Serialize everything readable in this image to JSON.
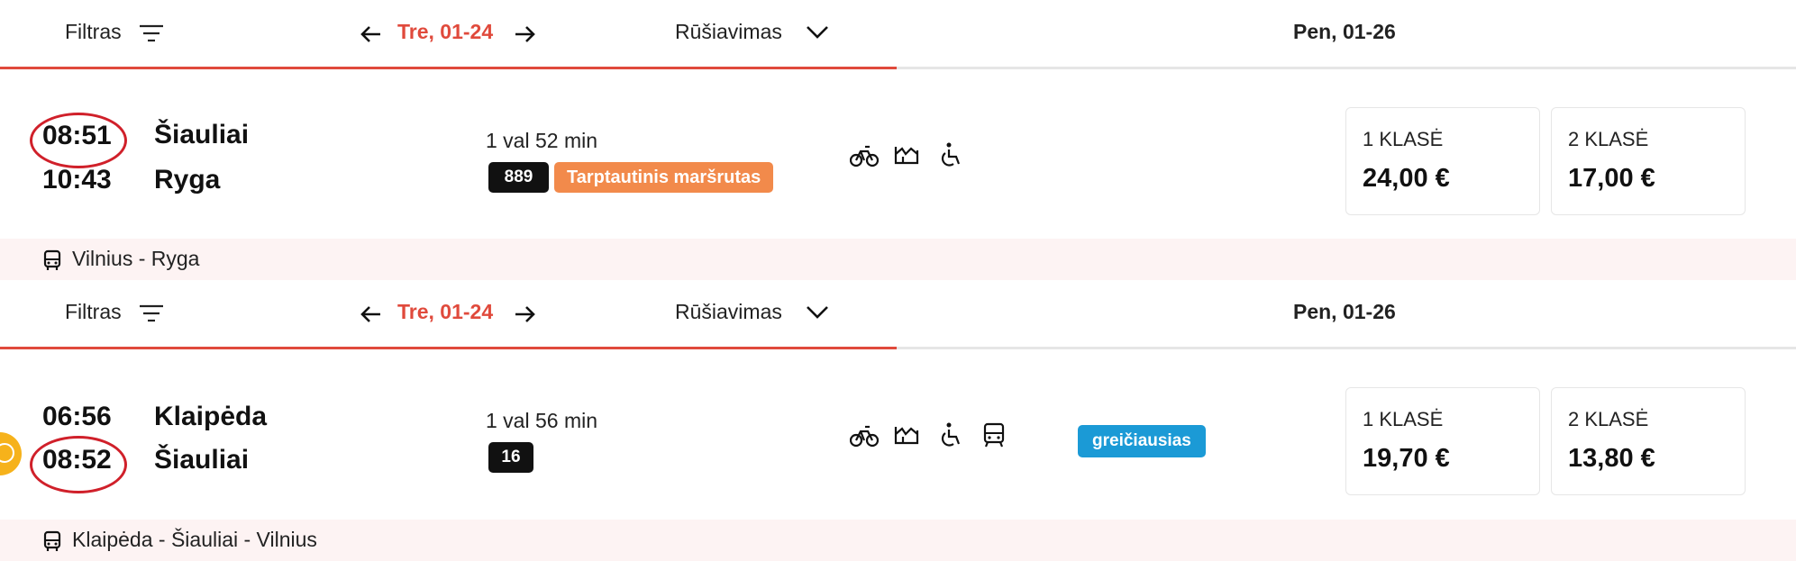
{
  "toolbar": {
    "filter_label": "Filtras",
    "date_current": "Tre, 01-24",
    "sort_label": "Rūšiavimas",
    "date_next": "Pen, 01-26"
  },
  "trips": [
    {
      "depart_time": "08:51",
      "arrive_time": "10:43",
      "from": "Šiauliai",
      "to": "Ryga",
      "duration": "1 val 52 min",
      "route_number": "889",
      "tag": "Tarptautinis maršrutas",
      "prices": [
        {
          "class": "1 KLASĖ",
          "price": "24,00 €"
        },
        {
          "class": "2 KLASĖ",
          "price": "17,00 €"
        }
      ],
      "route": "Vilnius - Ryga",
      "amenities": [
        "bicycle-icon",
        "pet-icon",
        "wheelchair-icon"
      ]
    },
    {
      "depart_time": "06:56",
      "arrive_time": "08:52",
      "from": "Klaipėda",
      "to": "Šiauliai",
      "duration": "1 val 56 min",
      "route_number": "16",
      "badge": "greičiausias",
      "prices": [
        {
          "class": "1 KLASĖ",
          "price": "19,70 €"
        },
        {
          "class": "2 KLASĖ",
          "price": "13,80 €"
        }
      ],
      "route": "Klaipėda - Šiauliai - Vilnius",
      "amenities": [
        "bicycle-icon",
        "pet-icon",
        "wheelchair-icon",
        "train-icon"
      ]
    }
  ],
  "colors": {
    "accent_red": "#e04a3c",
    "orange_tag": "#f28a4b",
    "blue_badge": "#1b9ad6",
    "annotation_circle": "#d0202a",
    "route_bar_bg": "#fdf3f3"
  }
}
